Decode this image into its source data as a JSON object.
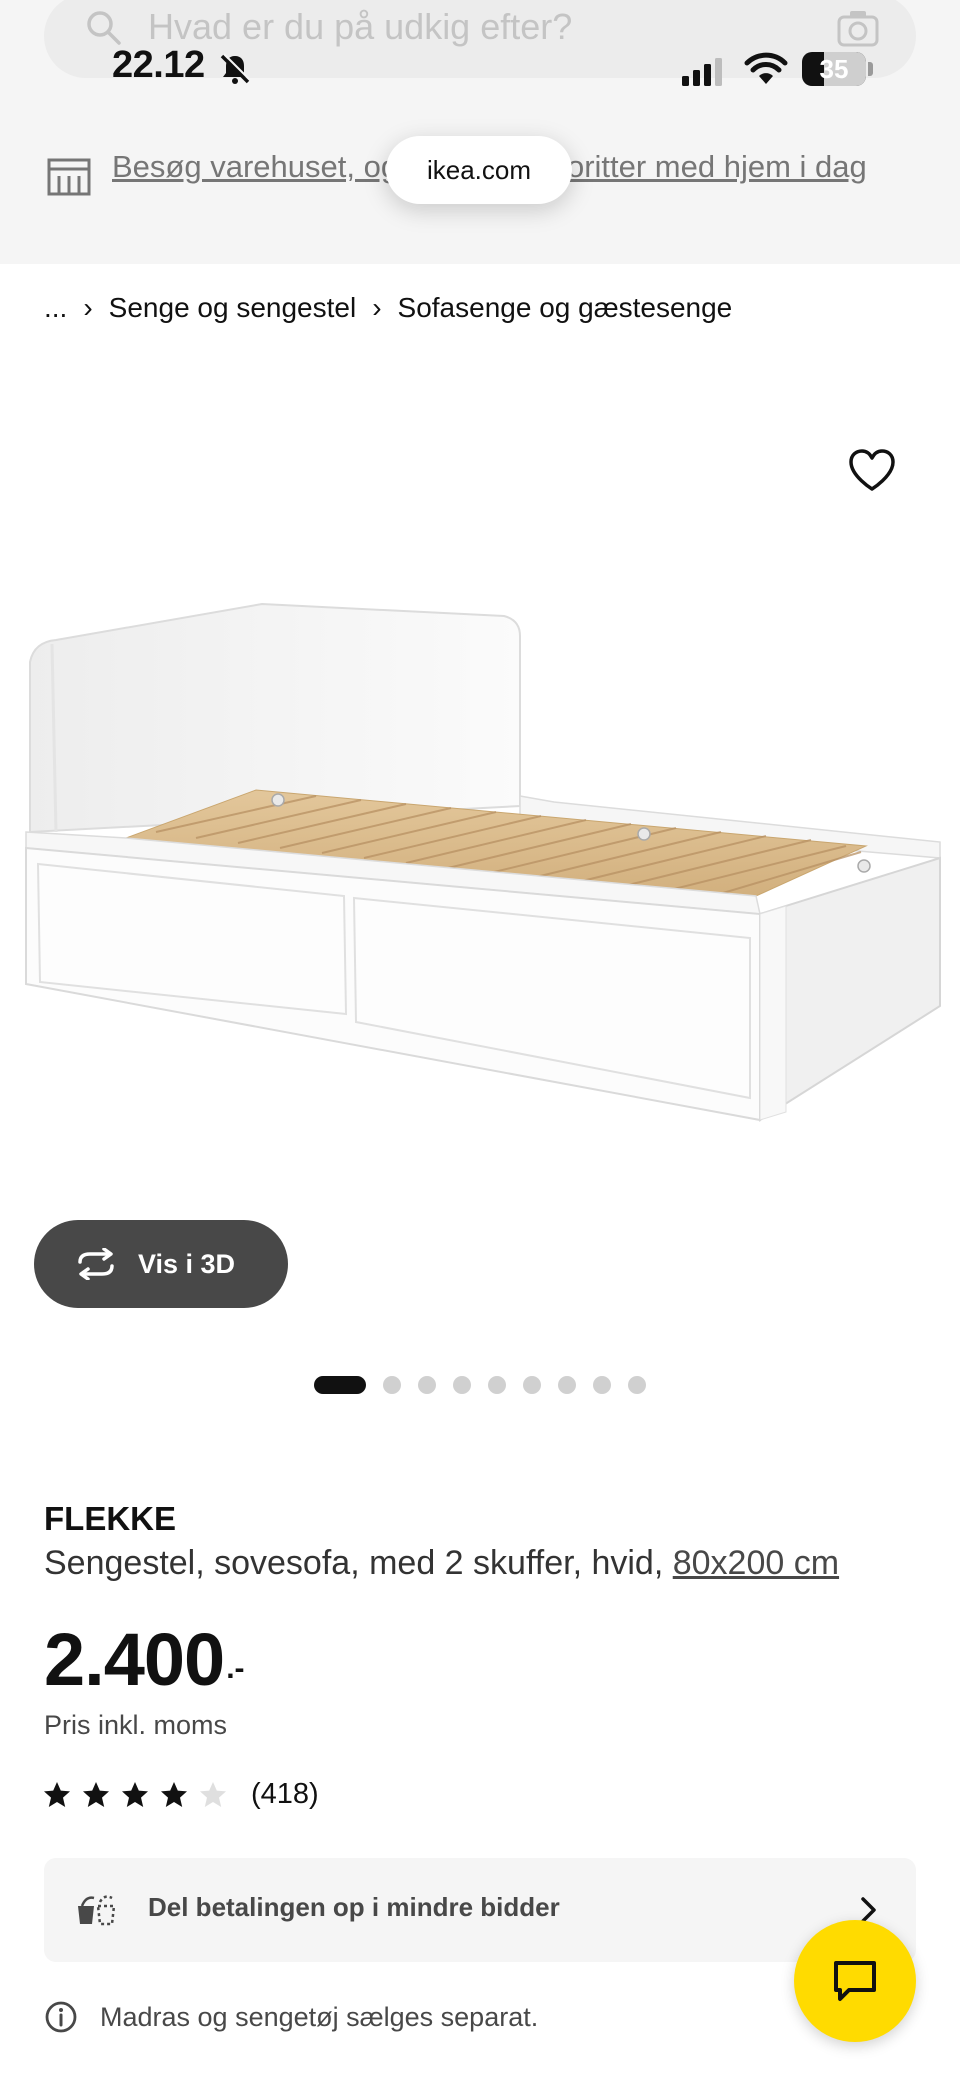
{
  "search": {
    "placeholder": "Hvad er du på udkig efter?",
    "icon": "search-icon",
    "camera_icon": "camera-icon"
  },
  "status_bar": {
    "time": "22.12",
    "battery": "35",
    "battery_level": 0.35
  },
  "browser": {
    "url": "ikea.com"
  },
  "store_banner": {
    "text": "Besøg varehuset, og tag dine favoritter med hjem i dag",
    "icon": "store-icon"
  },
  "breadcrumb": {
    "items": [
      "...",
      "Senge og sengestel",
      "Sofasenge og gæstesenge"
    ],
    "separator": "›"
  },
  "gallery": {
    "view_3d_label": "Vis i 3D",
    "image_count": 9,
    "active_index": 0
  },
  "product": {
    "name": "FLEKKE",
    "description": "Sengestel, sovesofa, med 2 skuffer, hvid, ",
    "size": "80x200 cm",
    "price": "2.400",
    "price_suffix": ".-",
    "price_note": "Pris inkl. moms",
    "rating": 4,
    "rating_max": 5,
    "review_count": "(418)"
  },
  "payment": {
    "label": "Del betalingen op i mindre bidder"
  },
  "notice": {
    "text": "Madras og sengetøj sælges separat."
  },
  "colors": {
    "brand_yellow": "#ffdb00",
    "text_dark": "#111111",
    "text_muted": "#484848",
    "surface": "#f5f5f5",
    "button_dark": "#484848"
  }
}
